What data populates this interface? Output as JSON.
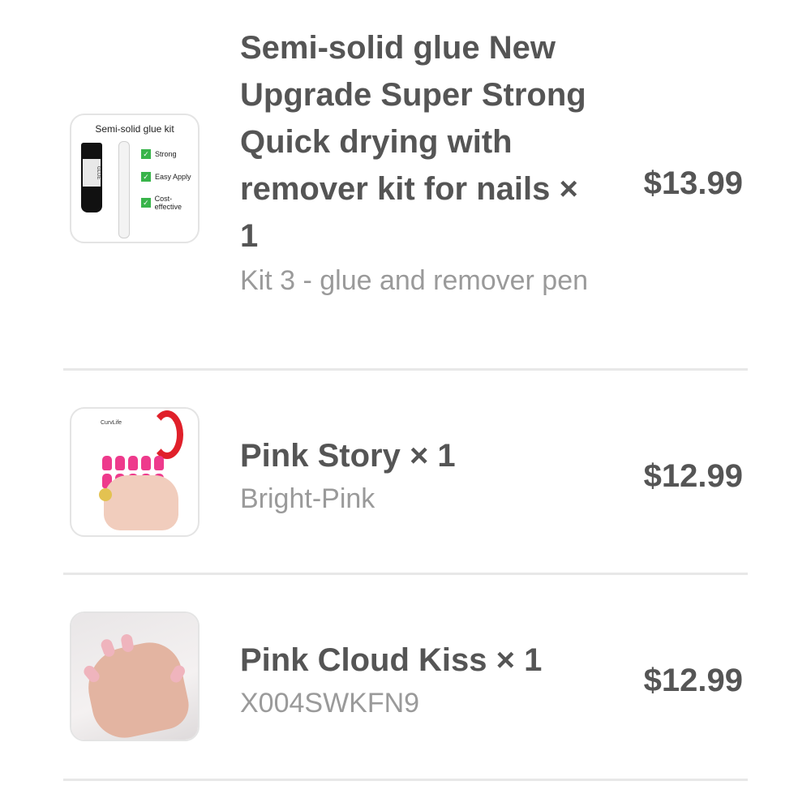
{
  "order_items": [
    {
      "title": "Semi-solid glue New Upgrade Super Strong Quick drying with remover kit for nails × 1",
      "variant": "Kit 3 - glue and remover pen",
      "price": "$13.99",
      "image": {
        "caption": "Semi-solid glue kit",
        "features": [
          "Strong",
          "Easy Apply",
          "Cost-effective"
        ]
      }
    },
    {
      "title": "Pink Story × 1",
      "variant": "Bright-Pink",
      "price": "$12.99",
      "image": {
        "brand": "CurvLife"
      }
    },
    {
      "title": "Pink Cloud Kiss × 1",
      "variant": "X004SWKFN9",
      "price": "$12.99"
    }
  ],
  "colors": {
    "text_primary": "#555555",
    "text_secondary": "#9a9a9a",
    "divider": "#e8e8e8",
    "check_green": "#38b44a",
    "nail_pink": "#ee3a8c"
  }
}
